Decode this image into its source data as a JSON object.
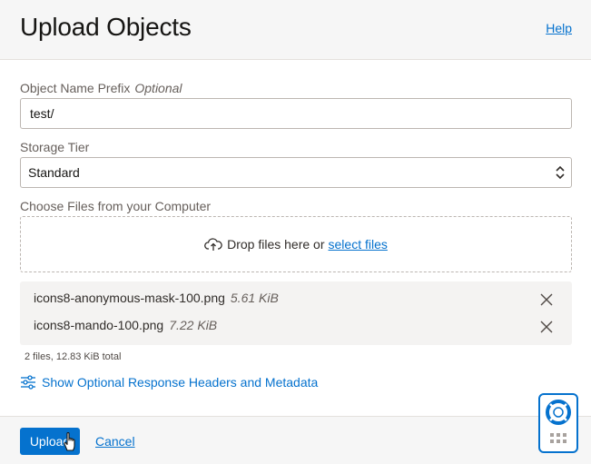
{
  "header": {
    "title": "Upload Objects",
    "help_label": "Help"
  },
  "prefix": {
    "label": "Object Name Prefix",
    "optional": "Optional",
    "value": "test/"
  },
  "storage_tier": {
    "label": "Storage Tier",
    "selected": "Standard"
  },
  "files_section": {
    "label": "Choose Files from your Computer",
    "drop_text": "Drop files here or",
    "select_files": "select files"
  },
  "files": [
    {
      "name": "icons8-anonymous-mask-100.png",
      "size": "5.61 KiB"
    },
    {
      "name": "icons8-mando-100.png",
      "size": "7.22 KiB"
    }
  ],
  "summary": "2 files, 12.83 KiB total",
  "optional_headers_label": "Show Optional Response Headers and Metadata",
  "footer": {
    "upload_label": "Upload",
    "cancel_label": "Cancel"
  },
  "colors": {
    "accent": "#0572ce",
    "header_bg": "#f6f6f6",
    "file_list_bg": "#f4f3f2"
  },
  "icons": [
    "upload-cloud-icon",
    "close-icon",
    "sliders-icon",
    "chevron-updown-icon",
    "lifebuoy-icon",
    "hand-cursor-icon"
  ]
}
